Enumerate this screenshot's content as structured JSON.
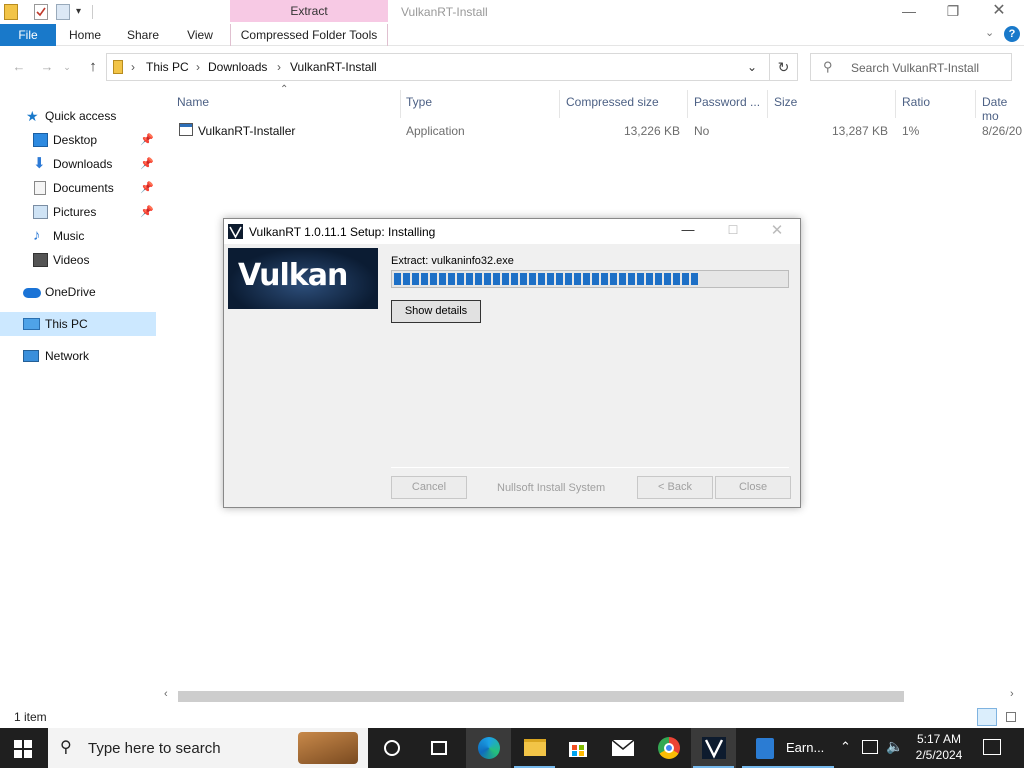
{
  "window": {
    "title": "VulkanRT-Install",
    "context_tab_group": "Extract",
    "accent": "#1979ca"
  },
  "ribbon": {
    "tabs": [
      "File",
      "Home",
      "Share",
      "View",
      "Compressed Folder Tools"
    ]
  },
  "address": {
    "breadcrumbs": [
      "This PC",
      "Downloads",
      "VulkanRT-Install"
    ],
    "search_placeholder": "Search VulkanRT-Install"
  },
  "nav": {
    "quick_access": "Quick access",
    "items": [
      "Desktop",
      "Downloads",
      "Documents",
      "Pictures",
      "Music",
      "Videos"
    ],
    "onedrive": "OneDrive",
    "this_pc": "This PC",
    "network": "Network"
  },
  "columns": [
    "Name",
    "Type",
    "Compressed size",
    "Password ...",
    "Size",
    "Ratio",
    "Date mo"
  ],
  "files": [
    {
      "name": "VulkanRT-Installer",
      "type": "Application",
      "compressed_size": "13,226 KB",
      "password": "No",
      "size": "13,287 KB",
      "ratio": "1%",
      "date": "8/26/20"
    }
  ],
  "status": {
    "item_count": "1 item"
  },
  "installer": {
    "title": "VulkanRT 1.0.11.1 Setup: Installing",
    "banner_text": "Vulkan",
    "extract_label": "Extract: vulkaninfo32.exe",
    "progress_fraction": 0.78,
    "show_details": "Show details",
    "cancel": "Cancel",
    "nsis_label": "Nullsoft Install System",
    "back": "< Back",
    "close": "Close"
  },
  "taskbar": {
    "search_placeholder": "Type here to search",
    "app_label": "Earn...",
    "time": "5:17 AM",
    "date": "2/5/2024"
  }
}
